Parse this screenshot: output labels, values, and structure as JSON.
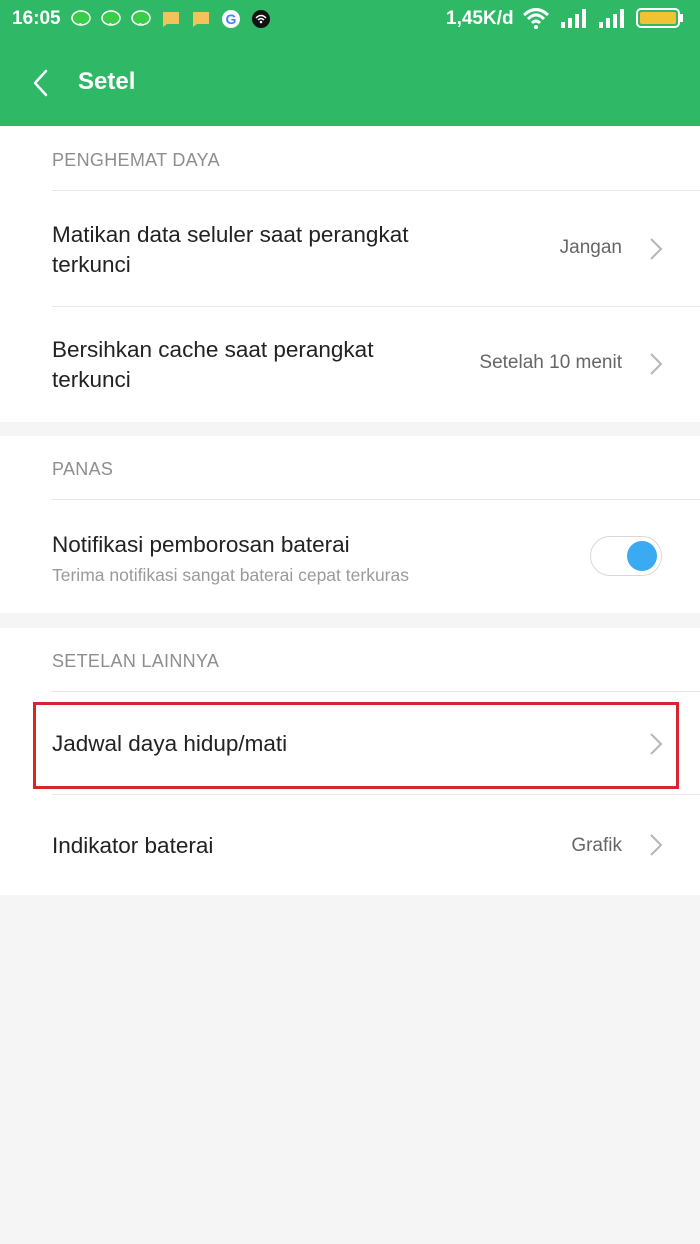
{
  "status_bar": {
    "time": "16:05",
    "speed": "1,45K/d",
    "icons": [
      "line-icon",
      "line-icon",
      "line-icon",
      "message-icon",
      "message-icon",
      "google-icon",
      "wifi-app-icon"
    ],
    "colors": {
      "line": "#3acd4a",
      "message": "#f4c15a",
      "battery": "#f1c232"
    }
  },
  "app_bar": {
    "title": "Setel"
  },
  "sections": {
    "power_saver": {
      "label": "PENGHEMAT DAYA",
      "items": [
        {
          "label_line1": "Matikan data seluler saat perangkat",
          "label_line2": "terkunci",
          "value": "Jangan"
        },
        {
          "label_line1": "Bersihkan cache saat perangkat",
          "label_line2": "terkunci",
          "value": "Setelah 10 menit"
        }
      ]
    },
    "heat": {
      "label": "PANAS",
      "items": [
        {
          "label": "Notifikasi pemborosan baterai",
          "sub": "Terima notifikasi sangat baterai cepat terkuras",
          "enabled": true
        }
      ]
    },
    "other": {
      "label": "SETELAN LAINNYA",
      "items": [
        {
          "label": "Jadwal daya hidup/mati",
          "value": ""
        },
        {
          "label": "Indikator baterai",
          "value": "Grafik"
        }
      ]
    }
  },
  "colors": {
    "header": "#2fb866",
    "toggle_on": "#3aaaf2",
    "highlight": "#d7252f"
  }
}
